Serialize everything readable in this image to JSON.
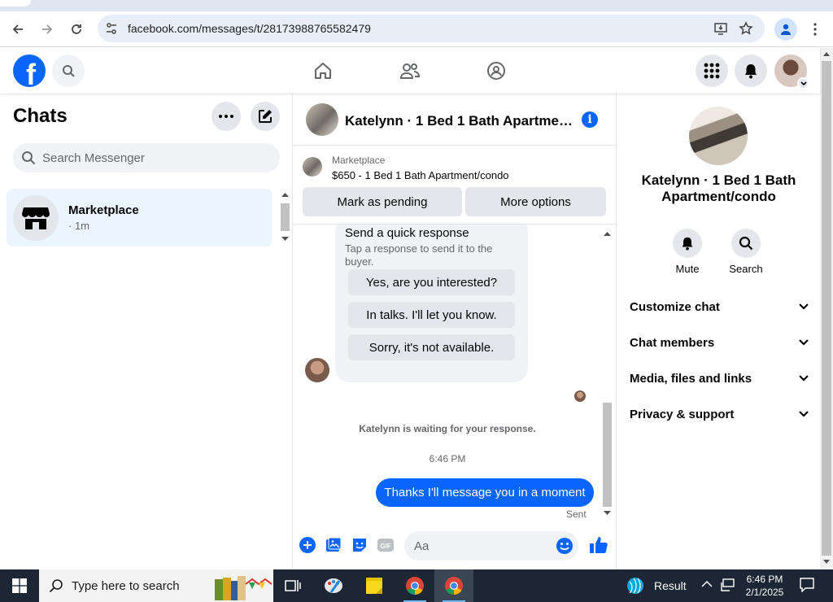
{
  "browser": {
    "url": "facebook.com/messages/t/28173988765582479"
  },
  "left": {
    "title": "Chats",
    "search_placeholder": "Search Messenger",
    "conversations": [
      {
        "name": "Marketplace",
        "time": "· 1m"
      }
    ]
  },
  "chat": {
    "header_title": "Katelynn · 1 Bed 1 Bath Apartmen…",
    "marketplace_label": "Marketplace",
    "listing": "$650 - 1 Bed 1 Bath Apartment/condo",
    "mark_pending": "Mark as pending",
    "more_options": "More options",
    "quick_response": {
      "title": "Send a quick response",
      "subtitle": "Tap a response to send it to the buyer.",
      "options": [
        "Yes, are you interested?",
        "In talks. I'll let you know.",
        "Sorry, it's not available."
      ]
    },
    "waiting_text": "Katelynn is waiting for your response.",
    "timestamp": "6:46 PM",
    "my_message": "Thanks I'll message you in a moment",
    "sent_label": "Sent",
    "composer_placeholder": "Aa"
  },
  "right": {
    "name": "Katelynn · 1 Bed 1 Bath Apartment/condo",
    "mute_label": "Mute",
    "search_label": "Search",
    "sections": [
      "Customize chat",
      "Chat members",
      "Media, files and links",
      "Privacy & support"
    ]
  },
  "taskbar": {
    "search_text": "Type here to search",
    "result_label": "Result",
    "time": "6:46 PM",
    "date": "2/1/2025"
  },
  "colors": {
    "brand": "#0866ff",
    "selected_conversation": "#ebf5ff",
    "taskbar": "#1c2634"
  }
}
